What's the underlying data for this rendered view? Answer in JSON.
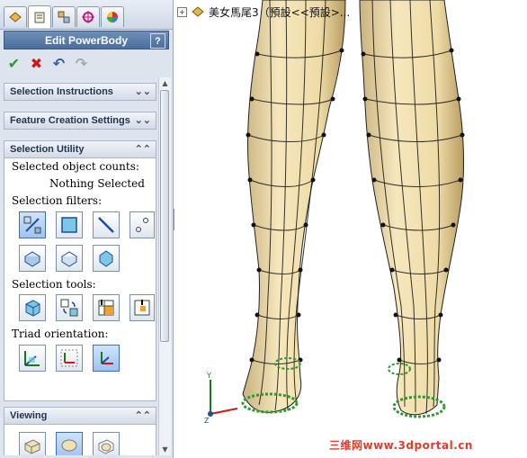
{
  "panel": {
    "title": "Edit PowerBody",
    "help": "?",
    "tabs": [
      "feature-manager-icon",
      "property-manager-icon",
      "configuration-manager-icon",
      "dimxpert-icon",
      "display-manager-icon"
    ],
    "actions": {
      "ok": "✔",
      "cancel": "✖",
      "undo": "↶",
      "redo": "↷"
    },
    "groups": {
      "selection_instructions": "Selection Instructions",
      "feature_creation": "Feature Creation Settings",
      "selection_utility": "Selection Utility",
      "viewing": "Viewing"
    },
    "selection_utility": {
      "counts_label": "Selected object counts:",
      "counts_value": "Nothing Selected",
      "filters_label": "Selection filters:",
      "tools_label": "Selection tools:",
      "triad_label": "Triad orientation:"
    }
  },
  "viewport": {
    "tree_root": "美女馬尾3（預設<<預設>..."
  },
  "watermark": "三维网www.3dportal.cn",
  "colors": {
    "skin": "#f1dfb0",
    "mesh": "#111111",
    "accent": "#4a6d9c",
    "ok": "#2b9a2b",
    "cancel": "#d01818",
    "watermark": "#e23b2b"
  }
}
